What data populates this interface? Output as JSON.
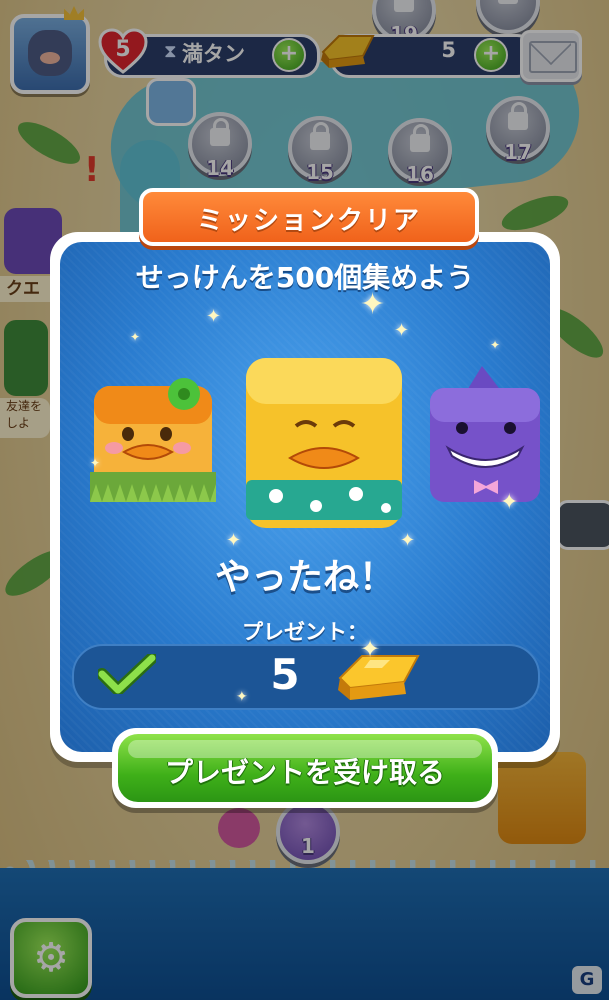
{
  "hud": {
    "lives_count": "5",
    "lives_status": "満タン",
    "gold_count": "5"
  },
  "map": {
    "levels": [
      "19",
      "14",
      "15",
      "16",
      "17",
      "1"
    ],
    "quest_label": "クエ",
    "friend_label": "友達を しよ"
  },
  "popup": {
    "ribbon_title": "ミッションクリア",
    "mission_text": "せっけんを500個集めよう",
    "congrats_text": "やったね！",
    "present_label": "プレゼント：",
    "reward_amount": "5",
    "receive_button_label": "プレゼントを受け取る"
  },
  "watermark": "G",
  "colors": {
    "popup_blue": "#2a7ccf",
    "ribbon_orange": "#f0621b",
    "button_green": "#3fb019",
    "hud_navy": "#2c3e6a"
  },
  "icons": [
    "heart-icon",
    "hourglass-icon",
    "plus-icon",
    "gold-bar-icon",
    "mail-icon",
    "lock-icon",
    "gear-icon",
    "checkmark-icon",
    "sparkle-icon"
  ]
}
